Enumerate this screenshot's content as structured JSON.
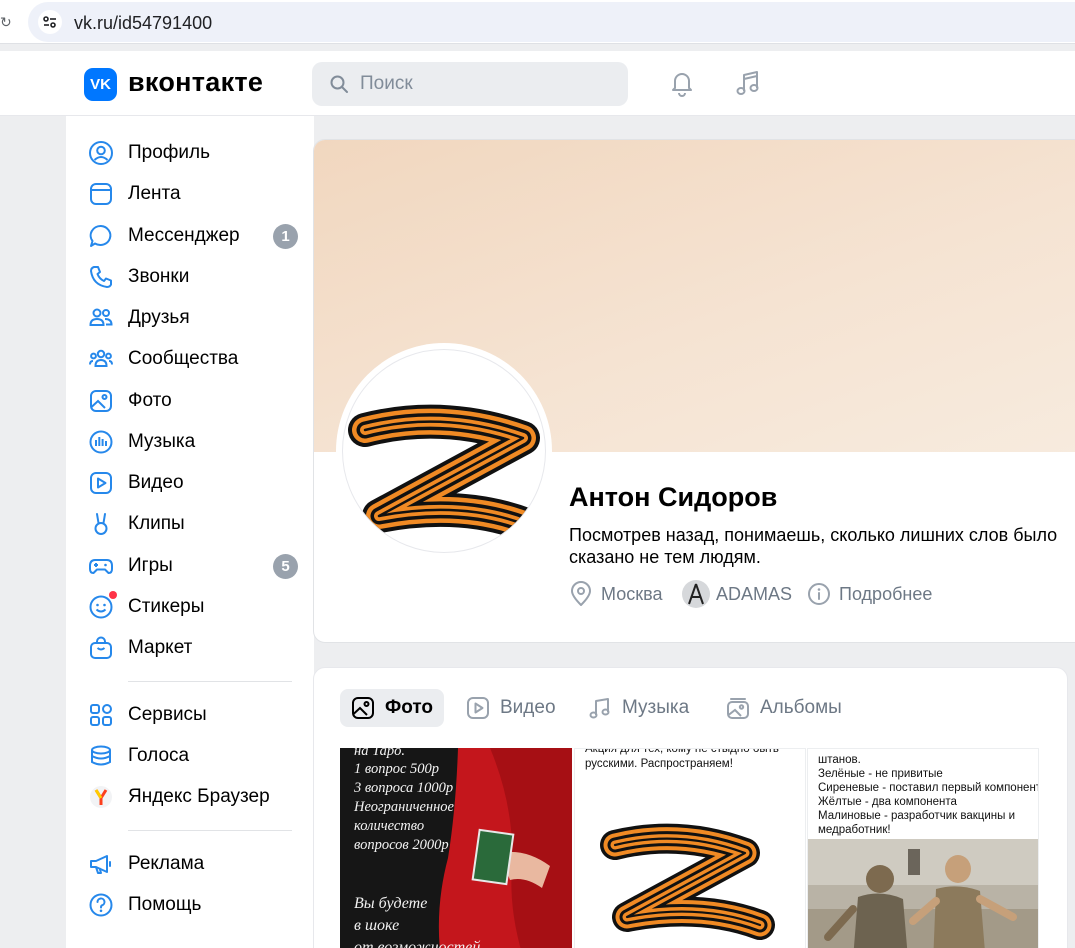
{
  "browser": {
    "url": "vk.ru/id54791400"
  },
  "header": {
    "logo_mark": "VK",
    "logo_text": "вконтакте",
    "search_placeholder": "Поиск",
    "icons": [
      "bell-icon",
      "music-note-icon"
    ]
  },
  "sidebar": {
    "items": [
      {
        "label": "Профиль",
        "icon": "profile-icon"
      },
      {
        "label": "Лента",
        "icon": "feed-icon"
      },
      {
        "label": "Мессенджер",
        "icon": "messenger-icon",
        "badge": "1"
      },
      {
        "label": "Звонки",
        "icon": "phone-icon"
      },
      {
        "label": "Друзья",
        "icon": "friends-icon"
      },
      {
        "label": "Сообщества",
        "icon": "communities-icon"
      },
      {
        "label": "Фото",
        "icon": "photo-icon"
      },
      {
        "label": "Музыка",
        "icon": "music-icon"
      },
      {
        "label": "Видео",
        "icon": "video-icon"
      },
      {
        "label": "Клипы",
        "icon": "clips-icon"
      },
      {
        "label": "Игры",
        "icon": "games-icon",
        "badge": "5"
      },
      {
        "label": "Стикеры",
        "icon": "stickers-icon"
      },
      {
        "label": "Маркет",
        "icon": "market-icon"
      },
      {
        "label": "Сервисы",
        "icon": "services-icon"
      },
      {
        "label": "Голоса",
        "icon": "votes-icon"
      },
      {
        "label": "Яндекс Браузер",
        "icon": "yandex-browser-icon"
      },
      {
        "label": "Реклама",
        "icon": "ads-icon"
      },
      {
        "label": "Помощь",
        "icon": "help-icon"
      }
    ]
  },
  "profile": {
    "name": "Антон Сидоров",
    "status_line1": "Посмотрев назад, понимаешь, сколько лишних слов было",
    "status_line2": "сказано не тем людям.",
    "city": "Москва",
    "workplace": "ADAMAS",
    "more": "Подробнее"
  },
  "media": {
    "tabs": [
      {
        "label": "Фото",
        "active": true
      },
      {
        "label": "Видео",
        "active": false
      },
      {
        "label": "Музыка",
        "active": false
      },
      {
        "label": "Альбомы",
        "active": false
      }
    ],
    "thumb1_lines": [
      "на Таро.",
      "1 вопрос 500р",
      "3 вопроса 1000р",
      "Неограниченное",
      "количество",
      "вопросов 2000р",
      "",
      "Вы будете",
      "в шоке",
      "от возможностей"
    ],
    "thumb2_lines": [
      "Акция для тех, кому не стыдно быть",
      "русскими. Распространяем!"
    ],
    "thumb3_lines": [
      "штанов.",
      "Зелёные - не привитые",
      "Сиреневые - поставил первый компонент",
      "Жёлтые - два компонента",
      "Малиновые - разработчик вакцины и",
      "медработник!"
    ]
  },
  "colors": {
    "accent": "#0077ff",
    "badge": "#99a2ad",
    "ribbon_orange": "#f08a24",
    "ribbon_black": "#111111"
  }
}
